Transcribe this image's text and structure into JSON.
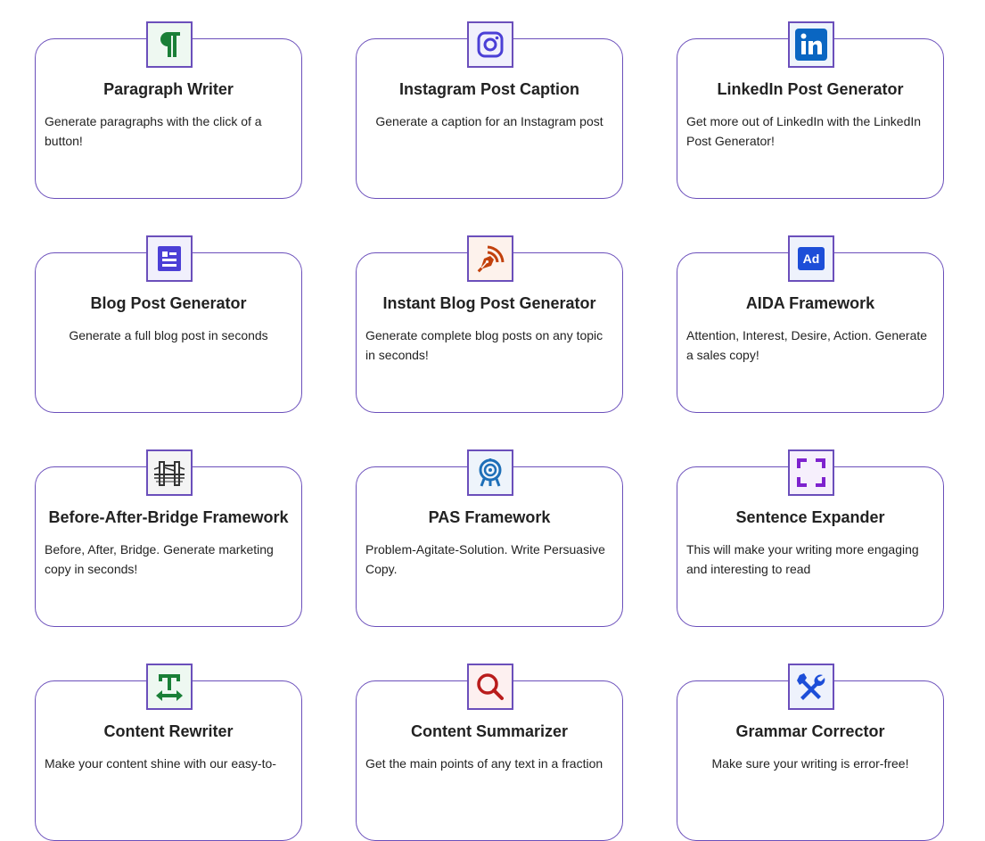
{
  "cards": [
    {
      "title": "Paragraph Writer",
      "description": "Generate paragraphs with the click of a button!",
      "icon": "paragraph-icon",
      "icon_color": "#1a7f37",
      "icon_bg": "#eef8f1"
    },
    {
      "title": "Instagram Post Caption",
      "description": "Generate a caption for an Instagram post",
      "icon": "instagram-icon",
      "icon_color": "#4b3fd6",
      "icon_bg": "#f1f0fc"
    },
    {
      "title": "LinkedIn Post Generator",
      "description": "Get more out of LinkedIn with the LinkedIn Post Generator!",
      "icon": "linkedin-icon",
      "icon_color": "#0a66c2",
      "icon_bg": "#eef4fb"
    },
    {
      "title": "Blog Post Generator",
      "description": "Generate a full blog post in seconds",
      "icon": "document-icon",
      "icon_color": "#4b3fd6",
      "icon_bg": "#f1f0fc"
    },
    {
      "title": "Instant Blog Post Generator",
      "description": "Generate complete blog posts on any topic in seconds!",
      "icon": "pen-nib-icon",
      "icon_color": "#c2410c",
      "icon_bg": "#fdf2ec"
    },
    {
      "title": "AIDA Framework",
      "description": "Attention, Interest, Desire, Action. Generate a sales copy!",
      "icon": "ad-icon",
      "icon_color": "#1d4ed8",
      "icon_bg": "#eef2fc"
    },
    {
      "title": "Before-After-Bridge Framework",
      "description": "Before, After, Bridge. Generate marketing copy in seconds!",
      "icon": "bridge-icon",
      "icon_color": "#333333",
      "icon_bg": "#f4f4f4"
    },
    {
      "title": "PAS Framework",
      "description": "Problem-Agitate-Solution. Write Persuasive Copy.",
      "icon": "target-icon",
      "icon_color": "#1e6fb8",
      "icon_bg": "#eef4fb"
    },
    {
      "title": "Sentence Expander",
      "description": "This will make your writing more engaging and interesting to read",
      "icon": "expand-icon",
      "icon_color": "#7e22ce",
      "icon_bg": "#f6effc"
    },
    {
      "title": "Content Rewriter",
      "description": "Make your content shine with our easy-to-",
      "icon": "text-width-icon",
      "icon_color": "#1a7f37",
      "icon_bg": "#eef8f1"
    },
    {
      "title": "Content Summarizer",
      "description": "Get the main points of any text in a fraction",
      "icon": "search-icon",
      "icon_color": "#b91c1c",
      "icon_bg": "#fdf0f0"
    },
    {
      "title": "Grammar Corrector",
      "description": "Make sure your writing is error-free!",
      "icon": "tools-icon",
      "icon_color": "#1d4ed8",
      "icon_bg": "#eef2fc"
    }
  ]
}
